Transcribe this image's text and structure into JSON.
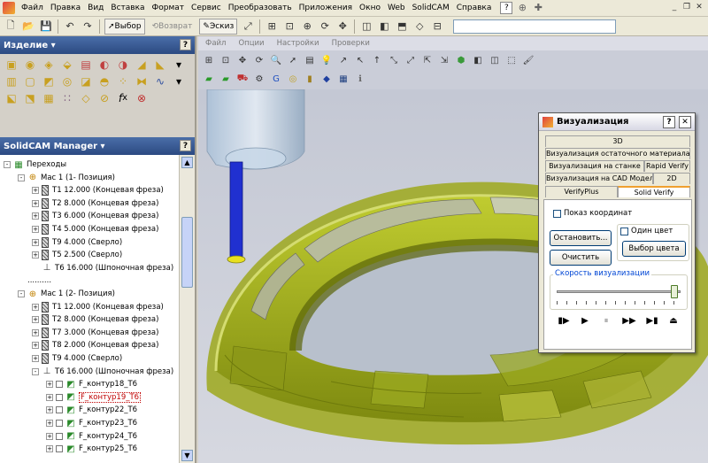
{
  "menubar": {
    "items": [
      "Файл",
      "Правка",
      "Вид",
      "Вставка",
      "Формат",
      "Сервис",
      "Преобразовать",
      "Приложения",
      "Окно",
      "Web",
      "SolidCAM",
      "Справка"
    ]
  },
  "toolbar": {
    "select_label": "Выбор",
    "back_label": "Возврат",
    "sketch_label": "Эскиз"
  },
  "left_panel": {
    "feature_title": "Изделие",
    "manager_title": "SolidCAM Manager"
  },
  "tree": [
    {
      "label": "Переходы",
      "level": 0,
      "icon": "operations-icon",
      "expander": "-"
    },
    {
      "label": "Мас 1 (1- Позиция)",
      "level": 1,
      "icon": "machine-coordinate-icon",
      "expander": "-"
    },
    {
      "label": "T1 12.000 (Концевая фреза)",
      "level": 2,
      "icon": "end-mill-icon",
      "expander": "+"
    },
    {
      "label": "T2 8.000 (Концевая фреза)",
      "level": 2,
      "icon": "end-mill-icon",
      "expander": "+"
    },
    {
      "label": "T3 6.000 (Концевая фреза)",
      "level": 2,
      "icon": "end-mill-icon",
      "expander": "+"
    },
    {
      "label": "T4 5.000 (Концевая фреза)",
      "level": 2,
      "icon": "end-mill-icon",
      "expander": "+"
    },
    {
      "label": "T9 4.000 (Сверло)",
      "level": 2,
      "icon": "drill-icon",
      "expander": "+"
    },
    {
      "label": "T5 2.500 (Сверло)",
      "level": 2,
      "icon": "drill-icon",
      "expander": "+"
    },
    {
      "label": "T6 16.000 (Шпоночная фреза)",
      "level": 2,
      "icon": "slot-mill-icon",
      "expander": ""
    },
    {
      "label": "..........",
      "level": 1,
      "icon": "",
      "expander": ""
    },
    {
      "label": "Мас 1 (2- Позиция)",
      "level": 1,
      "icon": "machine-coordinate-icon",
      "expander": "-"
    },
    {
      "label": "T1 12.000 (Концевая фреза)",
      "level": 2,
      "icon": "end-mill-icon",
      "expander": "+"
    },
    {
      "label": "T2 8.000 (Концевая фреза)",
      "level": 2,
      "icon": "end-mill-icon",
      "expander": "+"
    },
    {
      "label": "T7 3.000 (Концевая фреза)",
      "level": 2,
      "icon": "end-mill-icon",
      "expander": "+"
    },
    {
      "label": "T8 2.000 (Концевая фреза)",
      "level": 2,
      "icon": "end-mill-icon",
      "expander": "+"
    },
    {
      "label": "T9 4.000 (Сверло)",
      "level": 2,
      "icon": "drill-icon",
      "expander": "+"
    },
    {
      "label": "T6 16.000 (Шпоночная фреза)",
      "level": 2,
      "icon": "slot-mill-icon",
      "expander": "-"
    },
    {
      "label": "F_контур18_T6",
      "level": 3,
      "icon": "contour-op-icon",
      "expander": "+",
      "checkbox": true
    },
    {
      "label": "F_контур19_T6",
      "level": 3,
      "icon": "contour-op-icon",
      "expander": "+",
      "checkbox": true,
      "highlighted": true
    },
    {
      "label": "F_контур22_T6",
      "level": 3,
      "icon": "contour-op-icon",
      "expander": "+",
      "checkbox": true
    },
    {
      "label": "F_контур23_T6",
      "level": 3,
      "icon": "contour-op-icon",
      "expander": "+",
      "checkbox": true
    },
    {
      "label": "F_контур24_T6",
      "level": 3,
      "icon": "contour-op-icon",
      "expander": "+",
      "checkbox": true
    },
    {
      "label": "F_контур25_T6",
      "level": 3,
      "icon": "contour-op-icon",
      "expander": "+",
      "checkbox": true
    }
  ],
  "viewport_menu": [
    "Файл",
    "Опции",
    "Настройки",
    "Проверки"
  ],
  "dialog": {
    "title": "Визуализация",
    "tabs_row1": [
      "3D"
    ],
    "tabs_row2": [
      "Визуализация остаточного материала"
    ],
    "tabs_row3": [
      "Визуализация на станке",
      "Rapid Verify"
    ],
    "tabs_row4": [
      "Визуализация на CAD Модели",
      "2D"
    ],
    "tabs_row5": [
      "VerifyPlus",
      "Solid Verify"
    ],
    "show_coords_label": "Показ координат",
    "one_color_label": "Один цвет",
    "stop_label": "Остановить...",
    "clear_label": "Очистить",
    "choose_color_label": "Выбор цвета",
    "speed_label": "Скорость визуализации",
    "speed_level": 0.95
  },
  "colors": {
    "part": "#a8b41e",
    "highlight": "#c00000",
    "tool": "#2030d0"
  }
}
